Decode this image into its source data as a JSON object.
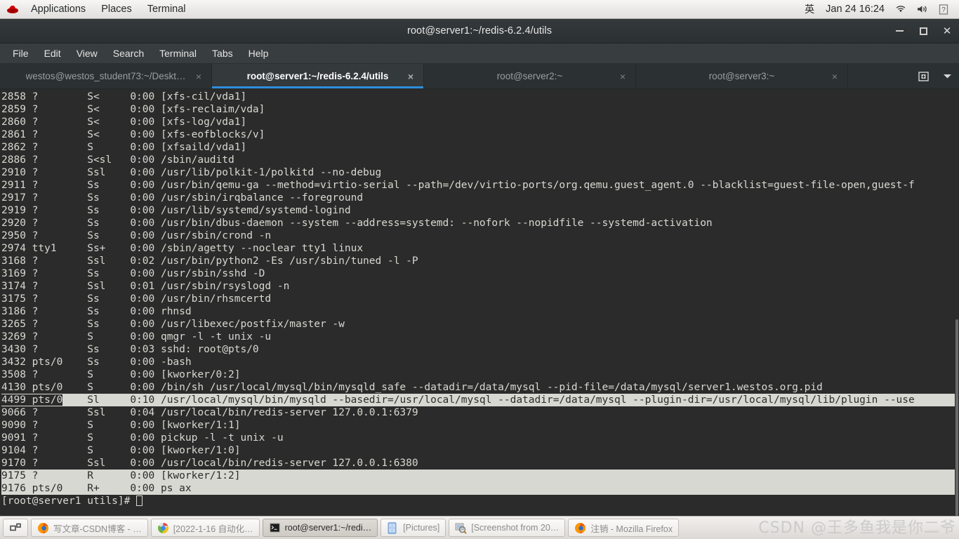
{
  "top_panel": {
    "logo_icon": "redhat-logo-icon",
    "menus": [
      {
        "label": "Applications",
        "name": "applications-menu"
      },
      {
        "label": "Places",
        "name": "places-menu"
      },
      {
        "label": "Terminal",
        "name": "terminal-menu"
      }
    ],
    "ime": "英",
    "clock": "Jan 24  16:24",
    "tray": [
      {
        "name": "network-wifi-icon"
      },
      {
        "name": "volume-icon"
      },
      {
        "name": "help-unknown-icon"
      }
    ]
  },
  "window": {
    "title": "root@server1:~/redis-6.2.4/utils",
    "buttons": {
      "minimize": "Minimize",
      "maximize": "Maximize",
      "close": "Close"
    }
  },
  "menubar": {
    "items": [
      {
        "label": "File"
      },
      {
        "label": "Edit"
      },
      {
        "label": "View"
      },
      {
        "label": "Search"
      },
      {
        "label": "Terminal"
      },
      {
        "label": "Tabs"
      },
      {
        "label": "Help"
      }
    ]
  },
  "tabs": {
    "items": [
      {
        "label": "westos@westos_student73:~/Deskt…",
        "active": false,
        "close": "×"
      },
      {
        "label": "root@server1:~/redis-6.2.4/utils",
        "active": true,
        "close": "×"
      },
      {
        "label": "root@server2:~",
        "active": false,
        "close": "×"
      },
      {
        "label": "root@server3:~",
        "active": false,
        "close": "×"
      }
    ],
    "new_tab_icon": "new-tab-icon",
    "menu_icon": "chevron-down-icon",
    "active_underline_color": "#2f8ddd"
  },
  "terminal": {
    "background": "#2b2b2b",
    "foreground": "#d8d8d2",
    "prompt": "[root@server1 utils]# ",
    "lines": [
      {
        "text": "2858 ?        S<     0:00 [xfs-cil/vda1]",
        "selected": false
      },
      {
        "text": "2859 ?        S<     0:00 [xfs-reclaim/vda]",
        "selected": false
      },
      {
        "text": "2860 ?        S<     0:00 [xfs-log/vda1]",
        "selected": false
      },
      {
        "text": "2861 ?        S<     0:00 [xfs-eofblocks/v]",
        "selected": false
      },
      {
        "text": "2862 ?        S      0:00 [xfsaild/vda1]",
        "selected": false
      },
      {
        "text": "2886 ?        S<sl   0:00 /sbin/auditd",
        "selected": false
      },
      {
        "text": "2910 ?        Ssl    0:00 /usr/lib/polkit-1/polkitd --no-debug",
        "selected": false
      },
      {
        "text": "2911 ?        Ss     0:00 /usr/bin/qemu-ga --method=virtio-serial --path=/dev/virtio-ports/org.qemu.guest_agent.0 --blacklist=guest-file-open,guest-f",
        "selected": false
      },
      {
        "text": "2917 ?        Ss     0:00 /usr/sbin/irqbalance --foreground",
        "selected": false
      },
      {
        "text": "2919 ?        Ss     0:00 /usr/lib/systemd/systemd-logind",
        "selected": false
      },
      {
        "text": "2920 ?        Ss     0:00 /usr/bin/dbus-daemon --system --address=systemd: --nofork --nopidfile --systemd-activation",
        "selected": false
      },
      {
        "text": "2950 ?        Ss     0:00 /usr/sbin/crond -n",
        "selected": false
      },
      {
        "text": "2974 tty1     Ss+    0:00 /sbin/agetty --noclear tty1 linux",
        "selected": false
      },
      {
        "text": "3168 ?        Ssl    0:02 /usr/bin/python2 -Es /usr/sbin/tuned -l -P",
        "selected": false
      },
      {
        "text": "3169 ?        Ss     0:00 /usr/sbin/sshd -D",
        "selected": false
      },
      {
        "text": "3174 ?        Ssl    0:01 /usr/sbin/rsyslogd -n",
        "selected": false
      },
      {
        "text": "3175 ?        Ss     0:00 /usr/bin/rhsmcertd",
        "selected": false
      },
      {
        "text": "3186 ?        Ss     0:00 rhnsd",
        "selected": false
      },
      {
        "text": "3265 ?        Ss     0:00 /usr/libexec/postfix/master -w",
        "selected": false
      },
      {
        "text": "3269 ?        S      0:00 qmgr -l -t unix -u",
        "selected": false
      },
      {
        "text": "3430 ?        Ss     0:03 sshd: root@pts/0",
        "selected": false
      },
      {
        "text": "3432 pts/0    Ss     0:00 -bash",
        "selected": false
      },
      {
        "text": "3508 ?        S      0:00 [kworker/0:2]",
        "selected": false
      },
      {
        "text": "4130 pts/0    S      0:00 /bin/sh /usr/local/mysql/bin/mysqld_safe --datadir=/data/mysql --pid-file=/data/mysql/server1.westos.org.pid",
        "selected": false
      },
      {
        "text": "4499 pts/0    Sl     0:10 /usr/local/mysql/bin/mysqld --basedir=/usr/local/mysql --datadir=/data/mysql --plugin-dir=/usr/local/mysql/lib/plugin --use",
        "selected": true,
        "pid_cell": "4499 pts/0"
      },
      {
        "text": "9066 ?        Ssl    0:04 /usr/local/bin/redis-server 127.0.0.1:6379",
        "selected": false
      },
      {
        "text": "9090 ?        S      0:00 [kworker/1:1]",
        "selected": false
      },
      {
        "text": "9091 ?        S      0:00 pickup -l -t unix -u",
        "selected": false
      },
      {
        "text": "9104 ?        S      0:00 [kworker/1:0]",
        "selected": false
      },
      {
        "text": "9170 ?        Ssl    0:00 /usr/local/bin/redis-server 127.0.0.1:6380",
        "selected": false
      },
      {
        "text": "9175 ?        R      0:00 [kworker/1:2]",
        "selected": true,
        "pid_cell": ""
      },
      {
        "text": "9176 pts/0    R+     0:00 ps ax",
        "selected": true,
        "pid_cell": ""
      }
    ],
    "command_executed": "ps ax"
  },
  "taskbar": {
    "switcher": {
      "name": "window-switcher-icon"
    },
    "items": [
      {
        "label": "写文章-CSDN博客 - …",
        "icon": "firefox-icon",
        "active": false
      },
      {
        "label": "[2022-1-16 自动化…",
        "icon": "chrome-icon",
        "active": false
      },
      {
        "label": "root@server1:~/redi…",
        "icon": "terminal-icon",
        "active": true
      },
      {
        "label": "[Pictures]",
        "icon": "file-manager-icon",
        "active": false
      },
      {
        "label": "[Screenshot from 20…",
        "icon": "screenshot-icon",
        "active": false
      },
      {
        "label": "注销 - Mozilla Firefox",
        "icon": "firefox-icon",
        "active": false
      }
    ]
  },
  "watermark": "CSDN @王多鱼我是你二爷"
}
